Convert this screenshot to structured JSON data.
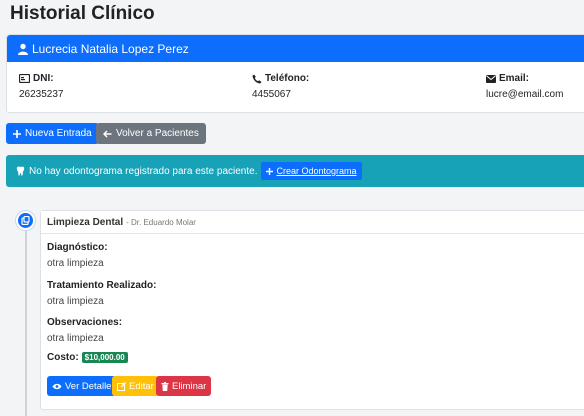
{
  "page": {
    "title": "Historial Clínico"
  },
  "patient": {
    "name": "Lucrecia Natalia Lopez Perez",
    "dni_label": "DNI:",
    "dni": "26235237",
    "phone_label": "Teléfono:",
    "phone": "4455067",
    "email_label": "Email:",
    "email": "lucre@email.com"
  },
  "actions": {
    "new_entry": "Nueva Entrada",
    "back": "Volver a Pacientes"
  },
  "alert": {
    "message": "No hay odontograma registrado para este paciente.",
    "create_label": "Crear Odontograma"
  },
  "entry": {
    "title": "Limpieza Dental",
    "doctor": "- Dr. Eduardo Molar",
    "diagnosis_label": "Diagnóstico:",
    "diagnosis": "otra limpieza",
    "treatment_label": "Tratamiento Realizado:",
    "treatment": "otra limpieza",
    "observations_label": "Observaciones:",
    "observations": "otra limpieza",
    "cost_label": "Costo:",
    "cost": "$10,000.00",
    "view_label": "Ver Detalle",
    "edit_label": "Editar",
    "delete_label": "Eliminar"
  },
  "colors": {
    "primary": "#0d6efd",
    "secondary": "#6c757d",
    "info": "#17a2b8",
    "success": "#198754",
    "warning": "#ffc107",
    "danger": "#dc3545"
  },
  "icons": [
    "user-icon",
    "id-card-icon",
    "phone-icon",
    "envelope-icon",
    "plus-icon",
    "arrow-left-icon",
    "tooth-icon",
    "clipboard-icon",
    "eye-icon",
    "edit-icon",
    "trash-icon"
  ]
}
